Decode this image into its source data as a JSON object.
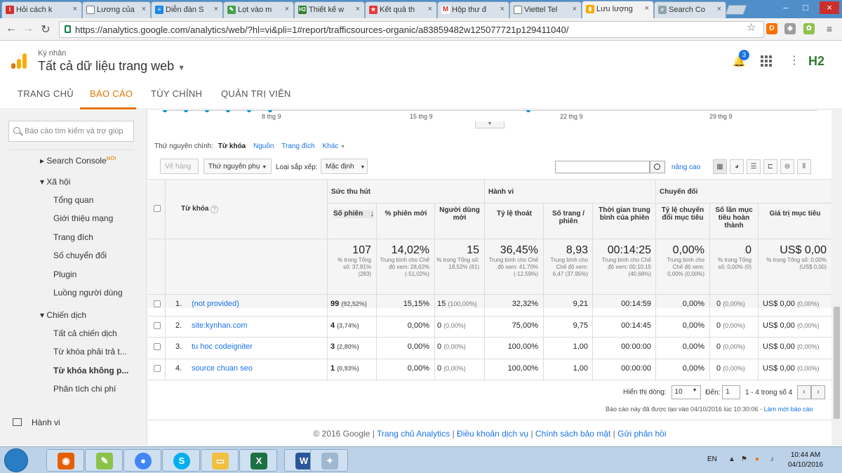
{
  "browser": {
    "tabs": [
      {
        "label": "Hỏi cách k",
        "icon": "idvs-icon"
      },
      {
        "label": "Lương của",
        "icon": "doc-icon"
      },
      {
        "label": "Diễn đàn S",
        "icon": "forum-icon"
      },
      {
        "label": "Lọt vào m",
        "icon": "leaf-icon"
      },
      {
        "label": "Thiết kế w",
        "icon": "h2-icon"
      },
      {
        "label": "Kết quả th",
        "icon": "star-icon"
      },
      {
        "label": "Hộp thư đ",
        "icon": "gmail-icon"
      },
      {
        "label": "Viettel Tel",
        "icon": "doc-icon"
      },
      {
        "label": "Lưu lượng",
        "icon": "analytics-icon"
      },
      {
        "label": "Search Co",
        "icon": "search-console-icon"
      }
    ],
    "url": "https://analytics.google.com/analytics/web/?hl=vi&pli=1#report/trafficsources-organic/a83859482w125077721p129411040/"
  },
  "header": {
    "account": "Ký nhân",
    "property": "Tất cả dữ liệu trang web",
    "notif_count": "3",
    "brand": "H2"
  },
  "nav": {
    "items": [
      "TRANG CHỦ",
      "BÁO CÁO",
      "TÙY CHỈNH",
      "QUẢN TRỊ VIÊN"
    ]
  },
  "sidebar": {
    "search_placeholder": "Báo cáo tìm kiếm và trợ giúp",
    "search_console": "Search Console",
    "new_badge": "MỚI",
    "xa_hoi": "Xã hội",
    "xa_hoi_items": [
      "Tổng quan",
      "Giới thiệu mạng",
      "Trang đích",
      "Số chuyển đổi",
      "Plugin",
      "Luồng người dùng"
    ],
    "chien_dich": "Chiến dịch",
    "chien_dich_items": [
      "Tất cả chiến dịch",
      "Từ khóa phải trả t...",
      "Từ khóa không p...",
      "Phân tích chi phí"
    ],
    "hanh_vi": "Hành vi"
  },
  "chart": {
    "x_labels": [
      "8 thg 9",
      "15 thg 9",
      "22 thg 9",
      "29 thg 9"
    ]
  },
  "dimension_bar": {
    "label": "Thứ nguyên chính:",
    "current": "Từ khóa",
    "others": [
      "Nguồn",
      "Trang đích",
      "Khác"
    ]
  },
  "toolbar": {
    "plot_rows": "Vẽ hàng",
    "secondary_dim": "Thứ nguyên phụ",
    "sort_label": "Loại sắp xếp:",
    "sort_value": "Mặc định",
    "advanced": "nâng cao"
  },
  "table": {
    "groups": [
      "Sức thu hút",
      "Hành vi",
      "Chuyển đổi"
    ],
    "dim_header": "Từ khóa",
    "columns": [
      "Số phiên",
      "% phiên mới",
      "Người dùng mới",
      "Tỷ lệ thoát",
      "Số trang / phiên",
      "Thời gian trung bình của phiên",
      "Tỷ lệ chuyển đổi mục tiêu",
      "Số lần mục tiêu hoàn thành",
      "Giá trị mục tiêu"
    ],
    "totals": [
      {
        "value": "107",
        "sub": "% trong Tổng số: 37,81% (283)"
      },
      {
        "value": "14,02%",
        "sub": "Trung bình cho Chế độ xem: 28,62% (-51,02%)"
      },
      {
        "value": "15",
        "sub": "% trong Tổng số: 18,52% (81)"
      },
      {
        "value": "36,45%",
        "sub": "Trung bình cho Chế độ xem: 41,70% (-12,59%)"
      },
      {
        "value": "8,93",
        "sub": "Trung bình cho Chế độ xem: 6,47 (37,95%)"
      },
      {
        "value": "00:14:25",
        "sub": "Trung bình cho Chế độ xem: 00:10:15 (40,68%)"
      },
      {
        "value": "0,00%",
        "sub": "Trung bình cho Chế độ xem: 0,00% (0,00%)"
      },
      {
        "value": "0",
        "sub": "% trong Tổng số: 0,00% (0)"
      },
      {
        "value": "US$ 0,00",
        "sub": "% trong Tổng số: 0,00% (US$ 0,00)"
      }
    ],
    "rows": [
      {
        "num": "1.",
        "keyword": "(not provided)",
        "sessions": "99",
        "sessions_pct": "(92,52%)",
        "new_pct": "15,15%",
        "new_users": "15",
        "new_users_pct": "(100,00%)",
        "bounce": "32,32%",
        "pages": "9,21",
        "duration": "00:14:59",
        "conv": "0,00%",
        "goals": "0",
        "goals_pct": "(0,00%)",
        "value": "US$ 0,00",
        "value_pct": "(0,00%)"
      },
      {
        "num": "2.",
        "keyword": "site:kynhan.com",
        "sessions": "4",
        "sessions_pct": "(3,74%)",
        "new_pct": "0,00%",
        "new_users": "0",
        "new_users_pct": "(0,00%)",
        "bounce": "75,00%",
        "pages": "9,75",
        "duration": "00:14:45",
        "conv": "0,00%",
        "goals": "0",
        "goals_pct": "(0,00%)",
        "value": "US$ 0,00",
        "value_pct": "(0,00%)"
      },
      {
        "num": "3.",
        "keyword": "tu hoc codeigniter",
        "sessions": "3",
        "sessions_pct": "(2,80%)",
        "new_pct": "0,00%",
        "new_users": "0",
        "new_users_pct": "(0,00%)",
        "bounce": "100,00%",
        "pages": "1,00",
        "duration": "00:00:00",
        "conv": "0,00%",
        "goals": "0",
        "goals_pct": "(0,00%)",
        "value": "US$ 0,00",
        "value_pct": "(0,00%)"
      },
      {
        "num": "4.",
        "keyword": "source chuan seo",
        "sessions": "1",
        "sessions_pct": "(0,93%)",
        "new_pct": "0,00%",
        "new_users": "0",
        "new_users_pct": "(0,00%)",
        "bounce": "100,00%",
        "pages": "1,00",
        "duration": "00:00:00",
        "conv": "0,00%",
        "goals": "0",
        "goals_pct": "(0,00%)",
        "value": "US$ 0,00",
        "value_pct": "(0,00%)"
      }
    ]
  },
  "pagination": {
    "show_rows_label": "Hiển thị dòng:",
    "show_rows_value": "10",
    "goto_label": "Đến:",
    "goto_value": "1",
    "range": "1 - 4 trong số 4"
  },
  "report_info": {
    "text": "Báo cáo này đã được tạo vào 04/10/2016 lúc 10:30:06 -",
    "refresh": "Làm mới báo cáo"
  },
  "footer": {
    "copyright": "© 2016 Google",
    "links": [
      "Trang chủ Analytics",
      "Điều khoản dịch vụ",
      "Chính sách bảo mật",
      "Gửi phản hồi"
    ]
  },
  "taskbar": {
    "lang": "EN",
    "time": "10:44 AM",
    "date": "04/10/2016"
  }
}
